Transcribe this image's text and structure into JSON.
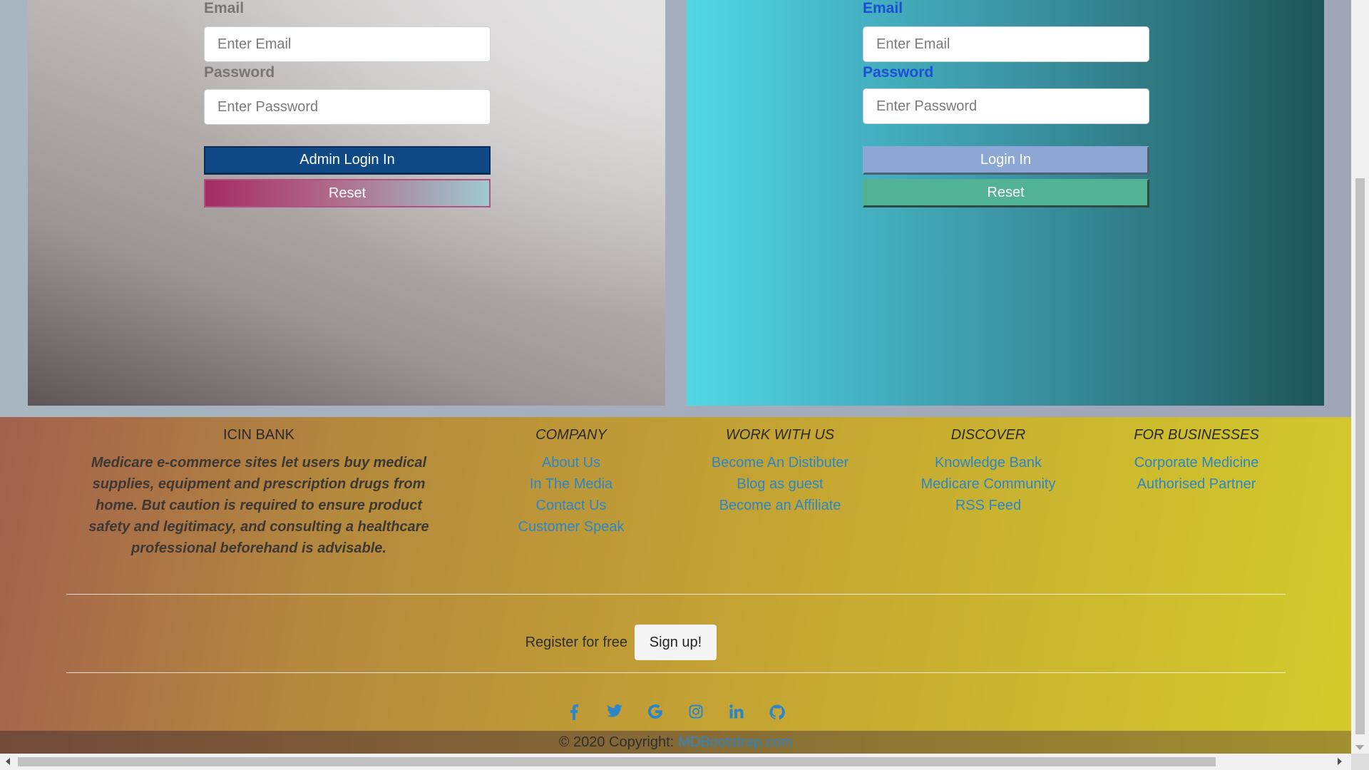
{
  "admin_form": {
    "email_label": "Email",
    "email_placeholder": "Enter Email",
    "password_label": "Password",
    "password_placeholder": "Enter Password",
    "login_button": "Admin Login In",
    "reset_button": "Reset"
  },
  "user_form": {
    "email_label": "Email",
    "email_placeholder": "Enter Email",
    "password_label": "Password",
    "password_placeholder": "Enter Password",
    "login_button": "Login In",
    "reset_button": "Reset"
  },
  "footer": {
    "brand": {
      "title": "ICIN BANK",
      "description": "Medicare e-commerce sites let users buy medical supplies, equipment and prescription drugs from home. But caution is required to ensure product safety and legitimacy, and consulting a healthcare professional beforehand is advisable."
    },
    "columns": [
      {
        "title": "COMPANY",
        "links": [
          "About Us",
          "In The Media",
          "Contact Us",
          "Customer Speak"
        ]
      },
      {
        "title": "WORK WITH US",
        "links": [
          "Become An Distibuter",
          "Blog as guest",
          "Become an Affiliate"
        ]
      },
      {
        "title": "DISCOVER",
        "links": [
          "Knowledge Bank",
          "Medicare Community",
          "RSS Feed"
        ]
      },
      {
        "title": "FOR BUSINESSES",
        "links": [
          "Corporate Medicine",
          "Authorised Partner"
        ]
      }
    ],
    "register_text": "Register for free",
    "signup_button": "Sign up!",
    "social_icons": [
      "facebook-icon",
      "twitter-icon",
      "google-icon",
      "instagram-icon",
      "linkedin-icon",
      "github-icon"
    ],
    "copyright_text": "© 2020 Copyright:",
    "copyright_link": "MDBootstrap.com"
  },
  "colors": {
    "admin_login": "#0f4a87",
    "user_login": "#8ca7d3",
    "user_reset": "#52b394",
    "link": "#2a86c8",
    "user_label": "#1d4fd6"
  }
}
